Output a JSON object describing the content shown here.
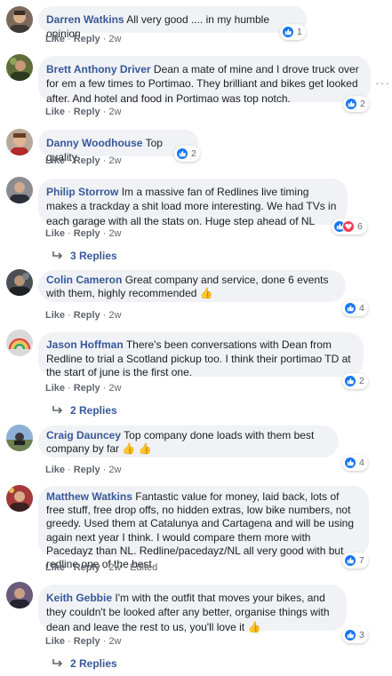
{
  "ui": {
    "like_label": "Like",
    "reply_label": "Reply",
    "more_options": "···",
    "thumb_emoji": "👍",
    "colors": {
      "author": "#385898",
      "bubble": "#f0f2f5",
      "like": "#1877f2",
      "love": "#f33e58"
    }
  },
  "comments": [
    {
      "author": "Darren Watkins",
      "text": "All very good .... in my humble opinion",
      "time": "2w",
      "reactions": 1,
      "reaction_types": [
        "like"
      ]
    },
    {
      "author": "Brett Anthony Driver",
      "text": "Dean a mate of mine and I drove truck over for em a few times to Portimao. They brilliant and bikes get looked after. And hotel and food in Portimao was top notch.",
      "time": "2w",
      "reactions": 2,
      "reaction_types": [
        "like"
      ]
    },
    {
      "author": "Danny Woodhouse",
      "text": "Top quality",
      "time": "2w",
      "reactions": 2,
      "reaction_types": [
        "like"
      ]
    },
    {
      "author": "Philip Storrow",
      "text": "Im a massive fan of Redlines live timing makes a trackday a shit load more interesting. We had TVs in each garage with all the stats on. Huge step ahead of NL",
      "time": "2w",
      "reactions": 6,
      "reaction_types": [
        "like",
        "love"
      ],
      "replies": "3 Replies"
    },
    {
      "author": "Colin Cameron",
      "text": "Great company and service, done 6 events with them, highly recommended",
      "time": "2w",
      "reactions": 4,
      "reaction_types": [
        "like"
      ]
    },
    {
      "author": "Jason Hoffman",
      "text": "There's been conversations with Dean from Redline to trial a Scotland pickup too. I think their portimao TD at the start of june is the first one.",
      "time": "2w",
      "reactions": 2,
      "reaction_types": [
        "like"
      ],
      "replies": "2 Replies"
    },
    {
      "author": "Craig Dauncey",
      "text": "Top company done loads with them best company by far",
      "time": "2w",
      "reactions": 4,
      "reaction_types": [
        "like"
      ]
    },
    {
      "author": "Matthew Watkins",
      "text": "Fantastic value for money, laid back, lots of free stuff, free drop offs, no hidden extras, low bike numbers, not greedy. Used them at Catalunya and Cartagena and will be using again next year I think. I would compare them more with Pacedayz than NL. Redline/pacedayz/NL all very good with but redline one of the best.",
      "time": "2w",
      "edited": "Edited",
      "reactions": 7,
      "reaction_types": [
        "like"
      ]
    },
    {
      "author": "Keith Gebbie",
      "text": "I'm with the outfit that moves your bikes, and they couldn't be looked after any better, organise things with dean and leave the rest to us, you'll love it",
      "time": "2w",
      "reactions": 3,
      "reaction_types": [
        "like"
      ],
      "replies": "2 Replies"
    }
  ]
}
